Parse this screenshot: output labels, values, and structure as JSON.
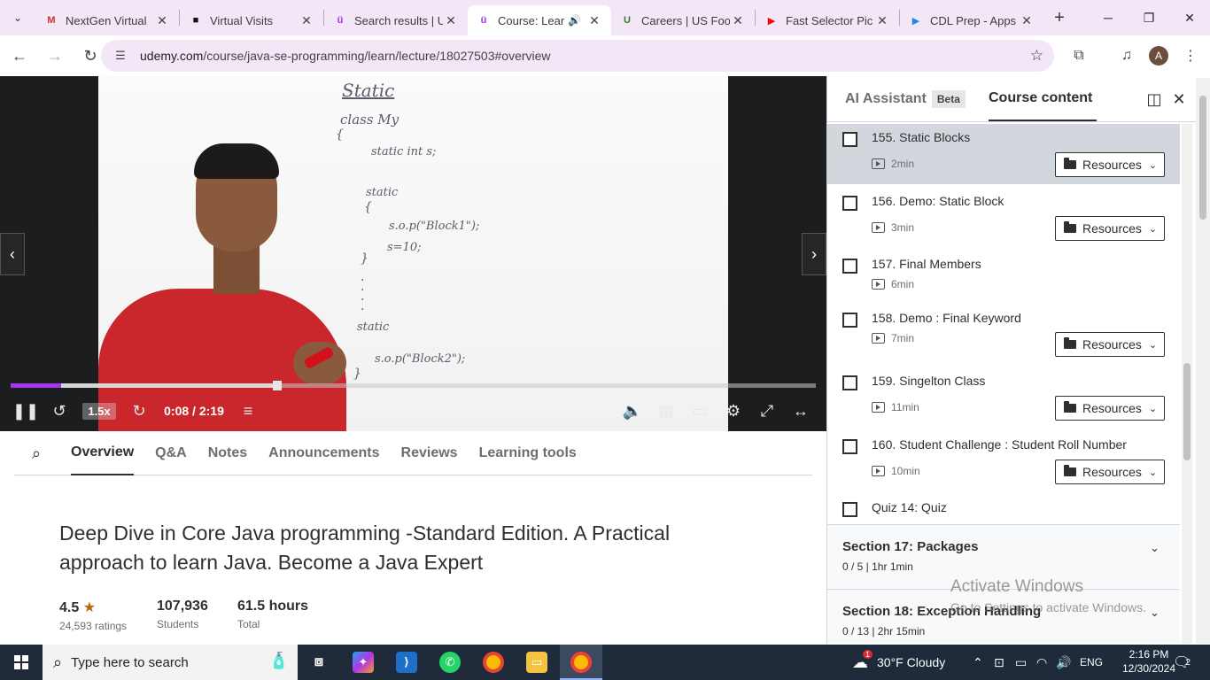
{
  "browser": {
    "tabs": [
      {
        "label": "NextGen Virtual",
        "icon": "gmail-icon",
        "color": "#d93025",
        "glyph": "M"
      },
      {
        "label": "Virtual Visits",
        "icon": "video-camera-icon",
        "color": "#111111",
        "glyph": "■"
      },
      {
        "label": "Search results | U",
        "icon": "udemy-icon",
        "color": "#a435f0",
        "glyph": "ü"
      },
      {
        "label": "Course: Lear",
        "icon": "udemy-icon",
        "color": "#a435f0",
        "glyph": "ü",
        "active": true
      },
      {
        "label": "Careers | US Foo",
        "icon": "usfoods-icon",
        "color": "#2e7d32",
        "glyph": "U"
      },
      {
        "label": "Fast Selector Pic",
        "icon": "youtube-icon",
        "color": "#ff0000",
        "glyph": "▶"
      },
      {
        "label": "CDL Prep - Apps",
        "icon": "play-store-icon",
        "color": "#1e88e5",
        "glyph": "▶"
      }
    ],
    "url_host": "udemy.com",
    "url_path": "/course/java-se-programming/learn/lecture/18027503#overview",
    "avatar_letter": "A"
  },
  "video": {
    "speed": "1.5x",
    "time": "0:08 / 2:19",
    "progress": 0.063,
    "buffered": 0.33,
    "whiteboard": {
      "title": "Static",
      "class_line": "class  My",
      "brace1": "{",
      "line1": "static  int  s;",
      "static1": "static",
      "brace2": "{",
      "sop1": "s.o.p(\"Block1\");",
      "assign": "s=10;",
      "brace3": "}",
      "static2": "static",
      "sop2": "s.o.p(\"Block2\");",
      "brace4": "}"
    }
  },
  "course_tabs": [
    "Overview",
    "Q&A",
    "Notes",
    "Announcements",
    "Reviews",
    "Learning tools"
  ],
  "course": {
    "title": "Deep Dive in Core Java programming -Standard Edition. A Practical approach to learn Java. Become a Java Expert",
    "rating": "4.5",
    "ratings_count": "24,593 ratings",
    "students": "107,936",
    "students_label": "Students",
    "hours": "61.5 hours",
    "hours_label": "Total"
  },
  "sidebar": {
    "tab_ai": "AI Assistant",
    "beta": "Beta",
    "tab_content": "Course content",
    "lectures": [
      {
        "title": "155. Static Blocks",
        "duration": "2min",
        "resources": "Resources"
      },
      {
        "title": "156. Demo: Static Block",
        "duration": "3min",
        "resources": "Resources"
      },
      {
        "title": "157. Final Members",
        "duration": "6min",
        "resources": ""
      },
      {
        "title": "158. Demo : Final Keyword",
        "duration": "7min",
        "resources": "Resources"
      },
      {
        "title": "159. Singelton Class",
        "duration": "11min",
        "resources": "Resources"
      },
      {
        "title": "160. Student Challenge : Student Roll Number",
        "duration": "10min",
        "resources": "Resources"
      },
      {
        "title": "Quiz 14: Quiz",
        "duration": "",
        "resources": ""
      }
    ],
    "sections": [
      {
        "title": "Section 17: Packages",
        "meta": "0 / 5 | 1hr 1min"
      },
      {
        "title": "Section 18: Exception Handling",
        "meta": "0 / 13 | 2hr 15min"
      }
    ]
  },
  "watermark": {
    "line1": "Activate Windows",
    "line2": "Go to Settings to activate Windows."
  },
  "taskbar": {
    "search_placeholder": "Type here to search",
    "weather": "30°F  Cloudy",
    "weather_badge": "1",
    "language": "ENG",
    "time": "2:16 PM",
    "date": "12/30/2024",
    "notifications": "2"
  }
}
